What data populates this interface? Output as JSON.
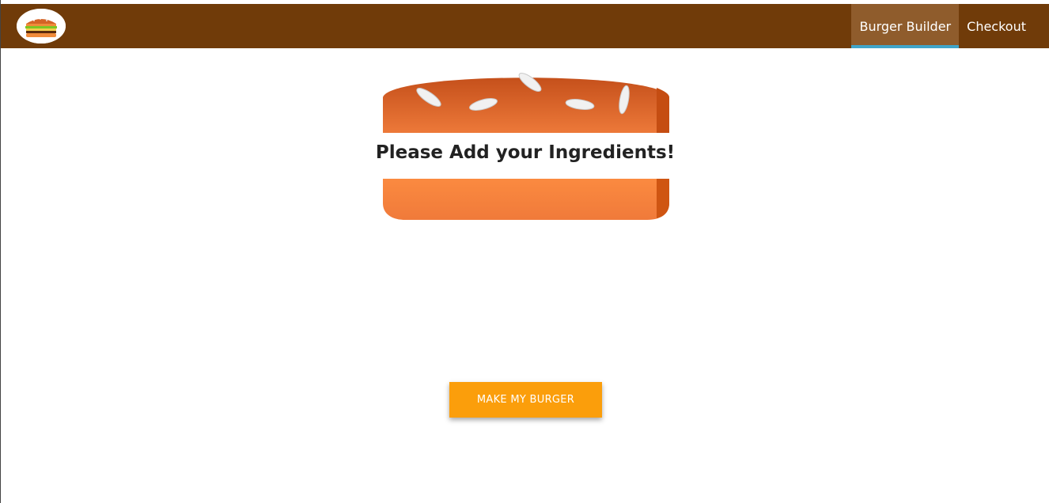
{
  "toolbar": {
    "logo_icon": "burger-logo-icon",
    "nav": [
      {
        "label": "Burger Builder",
        "active": true
      },
      {
        "label": "Checkout",
        "active": false
      }
    ]
  },
  "burger": {
    "message": "Please Add your Ingredients!",
    "top_bun_icon": "bread-top-icon",
    "bottom_bun_icon": "bread-bottom-icon"
  },
  "build_controls": {
    "order_label": "MAKE MY BURGER"
  },
  "colors": {
    "toolbar_bg": "#703b09",
    "active_tab_bg": "#8f5c2c",
    "active_underline": "#40a4c8",
    "order_button": "#fb9e0b",
    "bun": "#e27b36"
  }
}
